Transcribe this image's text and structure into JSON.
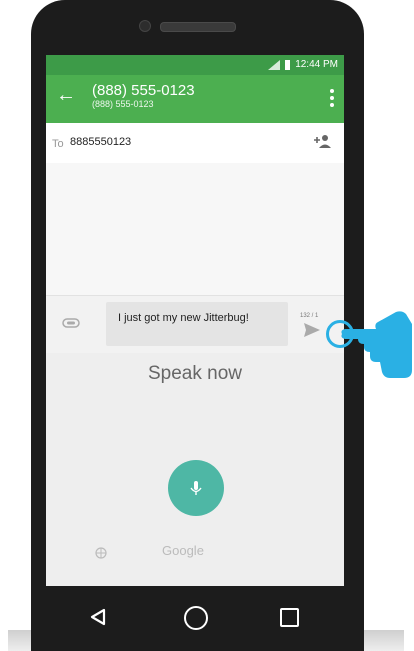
{
  "status": {
    "time": "12:44 PM"
  },
  "conversation": {
    "title": "(888) 555-0123",
    "subtitle": "(888) 555-0123"
  },
  "recipient": {
    "label": "To",
    "value": "8885550123"
  },
  "compose": {
    "message": "I just got my new Jitterbug!",
    "char_counter": "132 / 1"
  },
  "voice_input": {
    "prompt": "Speak now",
    "provider": "Google"
  },
  "icons": [
    "back-arrow-icon",
    "overflow-menu-icon",
    "add-contact-icon",
    "attach-icon",
    "send-icon",
    "microphone-icon",
    "globe-icon",
    "nav-back-icon",
    "nav-home-icon",
    "nav-recents-icon",
    "wifi-icon",
    "battery-icon",
    "pointing-hand-icon"
  ],
  "colors": {
    "toolbar": "#4caf50",
    "statusbar": "#3d9b48",
    "mic_button": "#4eb7a5",
    "highlight": "#2ab0e4"
  }
}
